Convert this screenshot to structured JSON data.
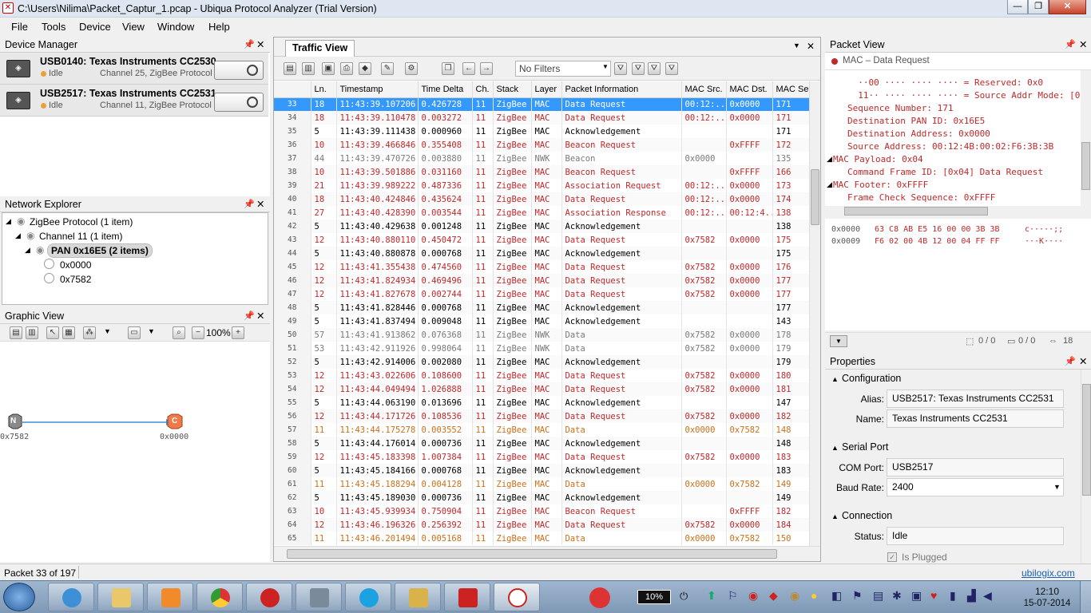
{
  "window": {
    "title": "C:\\Users\\Nilima\\Packet_Captur_1.pcap - Ubiqua Protocol Analyzer (Trial Version)",
    "min": "—",
    "max": "❐",
    "close": "✕"
  },
  "menu": [
    "File",
    "Tools",
    "Device",
    "View",
    "Window",
    "Help"
  ],
  "device_manager": {
    "title": "Device Manager",
    "devices": [
      {
        "name": "USB0140: Texas Instruments CC2530",
        "status": "Idle",
        "info": "Channel 25, ZigBee Protocol"
      },
      {
        "name": "USB2517: Texas Instruments CC2531",
        "status": "Idle",
        "info": "Channel 11, ZigBee Protocol"
      }
    ]
  },
  "network_explorer": {
    "title": "Network Explorer",
    "nodes": [
      "ZigBee Protocol (1 item)",
      "Channel 11 (1 item)",
      "PAN 0x16E5 (2 items)",
      "0x0000",
      "0x7582"
    ]
  },
  "graphic_view": {
    "title": "Graphic View",
    "zoom": "100%",
    "node_a": {
      "letter": "N",
      "label": "0x7582"
    },
    "node_b": {
      "letter": "C",
      "label": "0x0000"
    }
  },
  "traffic_view": {
    "tab": "Traffic View",
    "filter_placeholder": "No Filters",
    "columns": [
      "Ln.",
      "Timestamp",
      "Time Delta",
      "Ch.",
      "Stack",
      "Layer",
      "Packet Information",
      "MAC Src.",
      "MAC Dst.",
      "MAC Se"
    ],
    "rows": [
      [
        "33",
        "18",
        "11:43:39.107206",
        "0.426728",
        "11",
        "ZigBee",
        "MAC",
        "Data Request",
        "00:12:..",
        "0x0000",
        "171",
        "sel"
      ],
      [
        "34",
        "18",
        "11:43:39.110478",
        "0.003272",
        "11",
        "ZigBee",
        "MAC",
        "Data Request",
        "00:12:..",
        "0x0000",
        "171",
        "red"
      ],
      [
        "35",
        "5",
        "11:43:39.111438",
        "0.000960",
        "11",
        "ZigBee",
        "MAC",
        "Acknowledgement",
        "",
        "",
        "171",
        "blk"
      ],
      [
        "36",
        "10",
        "11:43:39.466846",
        "0.355408",
        "11",
        "ZigBee",
        "MAC",
        "Beacon Request",
        "",
        "0xFFFF",
        "172",
        "red"
      ],
      [
        "37",
        "44",
        "11:43:39.470726",
        "0.003880",
        "11",
        "ZigBee",
        "NWK",
        "Beacon",
        "0x0000",
        "",
        "135",
        "gry"
      ],
      [
        "38",
        "10",
        "11:43:39.501886",
        "0.031160",
        "11",
        "ZigBee",
        "MAC",
        "Beacon Request",
        "",
        "0xFFFF",
        "166",
        "red"
      ],
      [
        "39",
        "21",
        "11:43:39.989222",
        "0.487336",
        "11",
        "ZigBee",
        "MAC",
        "Association Request",
        "00:12:..",
        "0x0000",
        "173",
        "red"
      ],
      [
        "40",
        "18",
        "11:43:40.424846",
        "0.435624",
        "11",
        "ZigBee",
        "MAC",
        "Data Request",
        "00:12:..",
        "0x0000",
        "174",
        "red"
      ],
      [
        "41",
        "27",
        "11:43:40.428390",
        "0.003544",
        "11",
        "ZigBee",
        "MAC",
        "Association Response",
        "00:12:..",
        "00:12:4..",
        "138",
        "red"
      ],
      [
        "42",
        "5",
        "11:43:40.429638",
        "0.001248",
        "11",
        "ZigBee",
        "MAC",
        "Acknowledgement",
        "",
        "",
        "138",
        "blk"
      ],
      [
        "43",
        "12",
        "11:43:40.880110",
        "0.450472",
        "11",
        "ZigBee",
        "MAC",
        "Data Request",
        "0x7582",
        "0x0000",
        "175",
        "red"
      ],
      [
        "44",
        "5",
        "11:43:40.880878",
        "0.000768",
        "11",
        "ZigBee",
        "MAC",
        "Acknowledgement",
        "",
        "",
        "175",
        "blk"
      ],
      [
        "45",
        "12",
        "11:43:41.355438",
        "0.474560",
        "11",
        "ZigBee",
        "MAC",
        "Data Request",
        "0x7582",
        "0x0000",
        "176",
        "red"
      ],
      [
        "46",
        "12",
        "11:43:41.824934",
        "0.469496",
        "11",
        "ZigBee",
        "MAC",
        "Data Request",
        "0x7582",
        "0x0000",
        "177",
        "red"
      ],
      [
        "47",
        "12",
        "11:43:41.827678",
        "0.002744",
        "11",
        "ZigBee",
        "MAC",
        "Data Request",
        "0x7582",
        "0x0000",
        "177",
        "red"
      ],
      [
        "48",
        "5",
        "11:43:41.828446",
        "0.000768",
        "11",
        "ZigBee",
        "MAC",
        "Acknowledgement",
        "",
        "",
        "177",
        "blk"
      ],
      [
        "49",
        "5",
        "11:43:41.837494",
        "0.009048",
        "11",
        "ZigBee",
        "MAC",
        "Acknowledgement",
        "",
        "",
        "143",
        "blk"
      ],
      [
        "50",
        "57",
        "11:43:41.913862",
        "0.076368",
        "11",
        "ZigBee",
        "NWK",
        "Data",
        "0x7582",
        "0x0000",
        "178",
        "gry"
      ],
      [
        "51",
        "53",
        "11:43:42.911926",
        "0.998064",
        "11",
        "ZigBee",
        "NWK",
        "Data",
        "0x7582",
        "0x0000",
        "179",
        "gry"
      ],
      [
        "52",
        "5",
        "11:43:42.914006",
        "0.002080",
        "11",
        "ZigBee",
        "MAC",
        "Acknowledgement",
        "",
        "",
        "179",
        "blk"
      ],
      [
        "53",
        "12",
        "11:43:43.022606",
        "0.108600",
        "11",
        "ZigBee",
        "MAC",
        "Data Request",
        "0x7582",
        "0x0000",
        "180",
        "red"
      ],
      [
        "54",
        "12",
        "11:43:44.049494",
        "1.026888",
        "11",
        "ZigBee",
        "MAC",
        "Data Request",
        "0x7582",
        "0x0000",
        "181",
        "red"
      ],
      [
        "55",
        "5",
        "11:43:44.063190",
        "0.013696",
        "11",
        "ZigBee",
        "MAC",
        "Acknowledgement",
        "",
        "",
        "147",
        "blk"
      ],
      [
        "56",
        "12",
        "11:43:44.171726",
        "0.108536",
        "11",
        "ZigBee",
        "MAC",
        "Data Request",
        "0x7582",
        "0x0000",
        "182",
        "red"
      ],
      [
        "57",
        "11",
        "11:43:44.175278",
        "0.003552",
        "11",
        "ZigBee",
        "MAC",
        "Data",
        "0x0000",
        "0x7582",
        "148",
        "org"
      ],
      [
        "58",
        "5",
        "11:43:44.176014",
        "0.000736",
        "11",
        "ZigBee",
        "MAC",
        "Acknowledgement",
        "",
        "",
        "148",
        "blk"
      ],
      [
        "59",
        "12",
        "11:43:45.183398",
        "1.007384",
        "11",
        "ZigBee",
        "MAC",
        "Data Request",
        "0x7582",
        "0x0000",
        "183",
        "red"
      ],
      [
        "60",
        "5",
        "11:43:45.184166",
        "0.000768",
        "11",
        "ZigBee",
        "MAC",
        "Acknowledgement",
        "",
        "",
        "183",
        "blk"
      ],
      [
        "61",
        "11",
        "11:43:45.188294",
        "0.004128",
        "11",
        "ZigBee",
        "MAC",
        "Data",
        "0x0000",
        "0x7582",
        "149",
        "org"
      ],
      [
        "62",
        "5",
        "11:43:45.189030",
        "0.000736",
        "11",
        "ZigBee",
        "MAC",
        "Acknowledgement",
        "",
        "",
        "149",
        "blk"
      ],
      [
        "63",
        "10",
        "11:43:45.939934",
        "0.750904",
        "11",
        "ZigBee",
        "MAC",
        "Beacon Request",
        "",
        "0xFFFF",
        "182",
        "red"
      ],
      [
        "64",
        "12",
        "11:43:46.196326",
        "0.256392",
        "11",
        "ZigBee",
        "MAC",
        "Data Request",
        "0x7582",
        "0x0000",
        "184",
        "red"
      ],
      [
        "65",
        "11",
        "11:43:46.201494",
        "0.005168",
        "11",
        "ZigBee",
        "MAC",
        "Data",
        "0x0000",
        "0x7582",
        "150",
        "org"
      ]
    ]
  },
  "packet_view": {
    "title": "Packet View",
    "header": "MAC – Data Request",
    "lines": [
      "  ··00 ···· ···· ···· = Reserved: 0x0",
      "  11·· ···· ···· ···· = Source Addr Mode: [0x3",
      "Sequence Number: 171",
      "Destination PAN ID: 0x16E5",
      "Destination Address: 0x0000",
      "Source Address: 00:12:4B:00:02:F6:3B:3B",
      "MAC Payload: 0x04",
      "Command Frame ID: [0x04] Data Request",
      "MAC Footer: 0xFFFF",
      "Frame Check Sequence: 0xFFFF"
    ],
    "hex": [
      {
        "off": "0x0000",
        "bytes": "63 C8 AB E5 16 00 00 3B 3B",
        "ascii": "c·····;;"
      },
      {
        "off": "0x0009",
        "bytes": "F6 02 00 4B 12 00 04 FF FF",
        "ascii": "···K····"
      }
    ],
    "sel1": "0 / 0",
    "sel2": "0 / 0",
    "sel3": "18"
  },
  "properties": {
    "title": "Properties",
    "configuration": {
      "title": "Configuration",
      "alias_label": "Alias:",
      "alias": "USB2517: Texas Instruments CC2531",
      "name_label": "Name:",
      "name": "Texas Instruments CC2531"
    },
    "serial": {
      "title": "Serial Port",
      "com_label": "COM Port:",
      "com": "USB2517",
      "baud_label": "Baud Rate:",
      "baud": "2400"
    },
    "connection": {
      "title": "Connection",
      "status_label": "Status:",
      "status": "Idle",
      "plugged": "Is Plugged"
    }
  },
  "statusbar": {
    "text": "Packet 33 of 197",
    "link": "ubilogix.com"
  },
  "taskbar": {
    "battery": "10%",
    "time": "12:10",
    "date": "15-07-2014"
  }
}
